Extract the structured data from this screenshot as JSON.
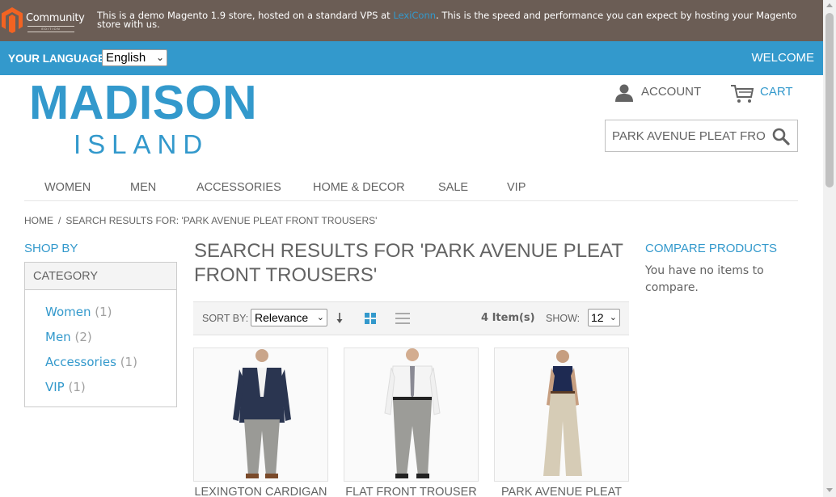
{
  "notice": {
    "logo_text": "Community",
    "logo_sub": "EDITION",
    "text_before": "This is a demo Magento 1.9 store, hosted on a standard VPS at ",
    "link_text": "LexiConn",
    "text_after": ". This is the speed and performance you can expect by hosting your Magento store with us."
  },
  "langbar": {
    "label": "YOUR LANGUAGE:",
    "selected": "English",
    "welcome": "WELCOME"
  },
  "header": {
    "logo_line1": "MADISON",
    "logo_line2": "ISLAND",
    "account_label": "ACCOUNT",
    "cart_label": "CART",
    "search_value": "PARK AVENUE PLEAT FRONT TROUSERS",
    "accent_color": "#3399cc"
  },
  "nav": {
    "items": [
      "WOMEN",
      "MEN",
      "ACCESSORIES",
      "HOME & DECOR",
      "SALE",
      "VIP"
    ]
  },
  "breadcrumb": {
    "home": "HOME",
    "separator": "/",
    "current": "SEARCH RESULTS FOR: 'PARK AVENUE PLEAT FRONT TROUSERS'"
  },
  "sidebar": {
    "shop_by": "SHOP BY",
    "category_title": "CATEGORY",
    "categories": [
      {
        "name": "Women",
        "count": "(1)"
      },
      {
        "name": "Men",
        "count": "(2)"
      },
      {
        "name": "Accessories",
        "count": "(1)"
      },
      {
        "name": "VIP",
        "count": "(1)"
      }
    ]
  },
  "main": {
    "title": "SEARCH RESULTS FOR 'PARK AVENUE PLEAT FRONT TROUSERS'",
    "toolbar": {
      "sort_label": "SORT BY:",
      "sort_value": "Relevance",
      "item_count": "4 Item(s)",
      "show_label": "SHOW:",
      "limit_value": "12"
    },
    "products": [
      {
        "name": "LEXINGTON CARDIGAN"
      },
      {
        "name": "FLAT FRONT TROUSER"
      },
      {
        "name": "PARK AVENUE PLEAT"
      }
    ]
  },
  "compare": {
    "title": "COMPARE PRODUCTS",
    "text": "You have no items to compare."
  }
}
